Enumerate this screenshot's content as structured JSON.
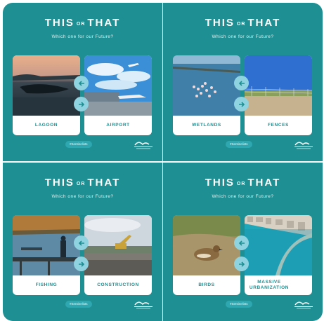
{
  "header": {
    "title_left": "THIS",
    "title_or": "OR",
    "title_right": "THAT",
    "subtitle": "Which one for our Future?"
  },
  "hashtag": "#Sentinelists",
  "colors": {
    "tile_background": "#1e8f92",
    "caption_text": "#1e8f92",
    "arrow_circle": "#8fd3e0",
    "hashtag_pill": "#2fa7b0"
  },
  "tiles": [
    {
      "left_label": "LAGOON",
      "right_label": "AIRPORT"
    },
    {
      "left_label": "WETLANDS",
      "right_label": "FENCES"
    },
    {
      "left_label": "FISHING",
      "right_label": "CONSTRUCTION"
    },
    {
      "left_label": "BIRDS",
      "right_label": "MASSIVE URBANIZATION"
    }
  ],
  "icons": {
    "arrow_left": "arrow-left-icon",
    "arrow_right": "arrow-right-icon",
    "logo": "organization-logo"
  }
}
